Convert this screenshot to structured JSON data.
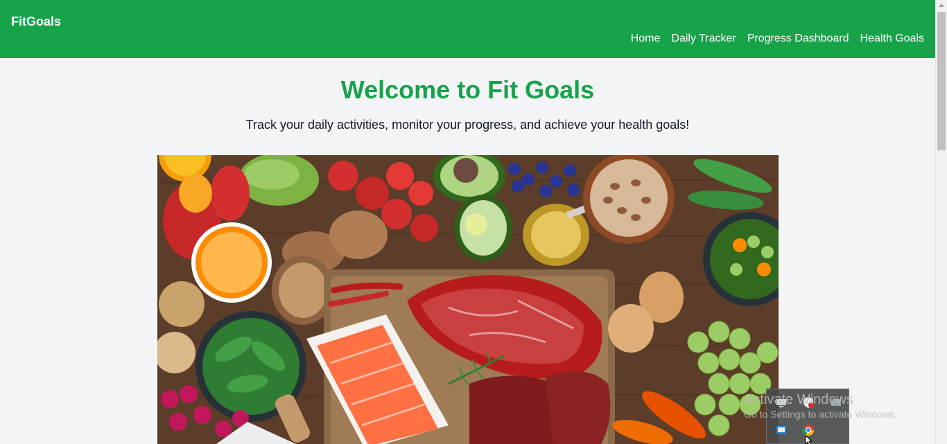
{
  "brand": {
    "name": "FitGoals"
  },
  "nav": {
    "items": [
      {
        "label": "Home"
      },
      {
        "label": "Daily Tracker"
      },
      {
        "label": "Progress Dashboard"
      },
      {
        "label": "Health Goals"
      }
    ]
  },
  "hero": {
    "title": "Welcome to Fit Goals",
    "subtitle": "Track your daily activities, monitor your progress, and achieve your health goals!"
  },
  "watermark": {
    "title": "Activate Windows",
    "subtitle": "Go to Settings to activate Windows."
  },
  "colors": {
    "brand_green": "#16a34a",
    "page_background": "#f3f4f6",
    "nav_text": "#ffffff"
  },
  "icons": {
    "tray": [
      "network-icon",
      "security-shield-icon",
      "display-icon",
      "task-icon",
      "chrome-icon"
    ]
  }
}
